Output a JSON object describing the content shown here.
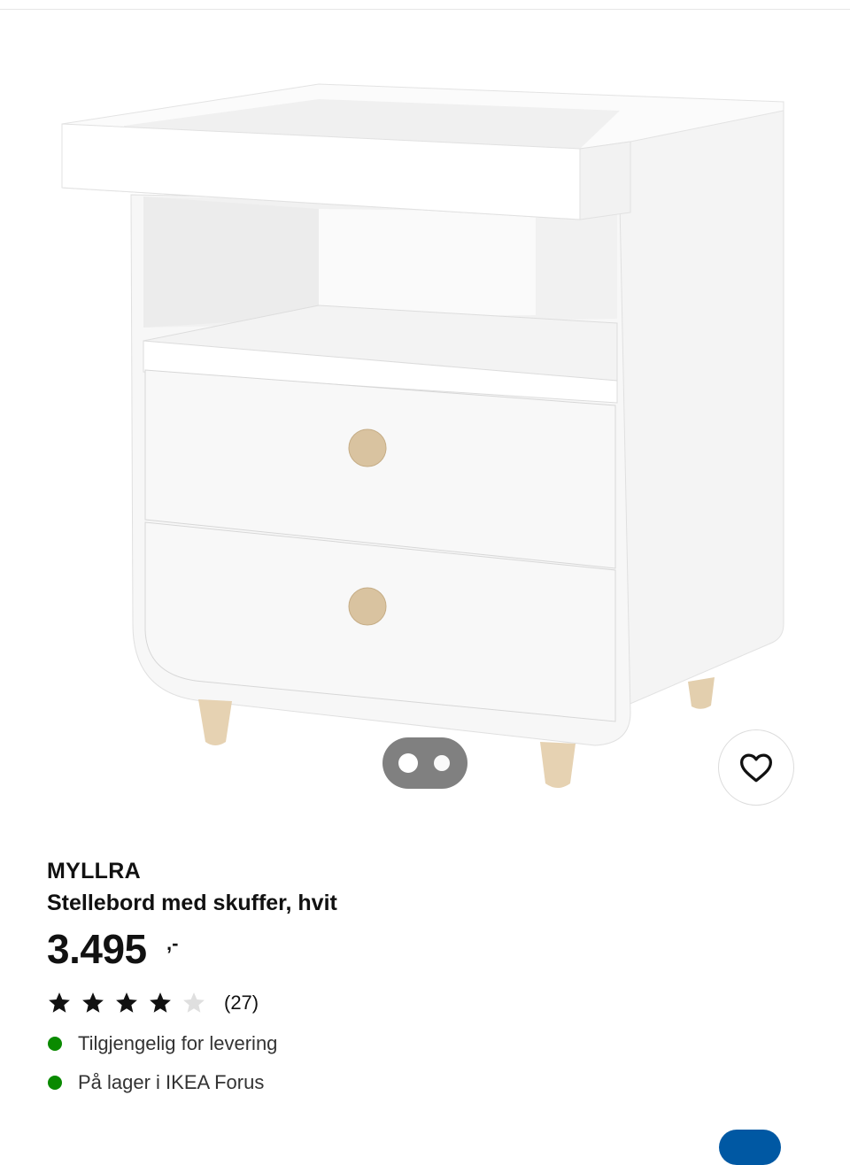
{
  "product": {
    "brand": "MYLLRA",
    "description": "Stellebord med skuffer, hvit",
    "price": "3.495",
    "price_suffix": ",-",
    "rating": {
      "stars_filled": 4,
      "stars_total": 5,
      "count_label": "(27)"
    },
    "availability": [
      {
        "text": "Tilgjengelig for levering",
        "status_color": "#0a8a00"
      },
      {
        "text": "På lager i IKEA Forus",
        "status_color": "#0a8a00"
      }
    ]
  },
  "carousel": {
    "slides": 2,
    "active": 1
  },
  "icons": {
    "favorite": "heart-icon",
    "star": "star-icon"
  },
  "colors": {
    "accent_blue": "#0058a3",
    "carousel_bg": "#808080",
    "star_filled": "#111111",
    "star_empty": "#dfdfdf"
  }
}
